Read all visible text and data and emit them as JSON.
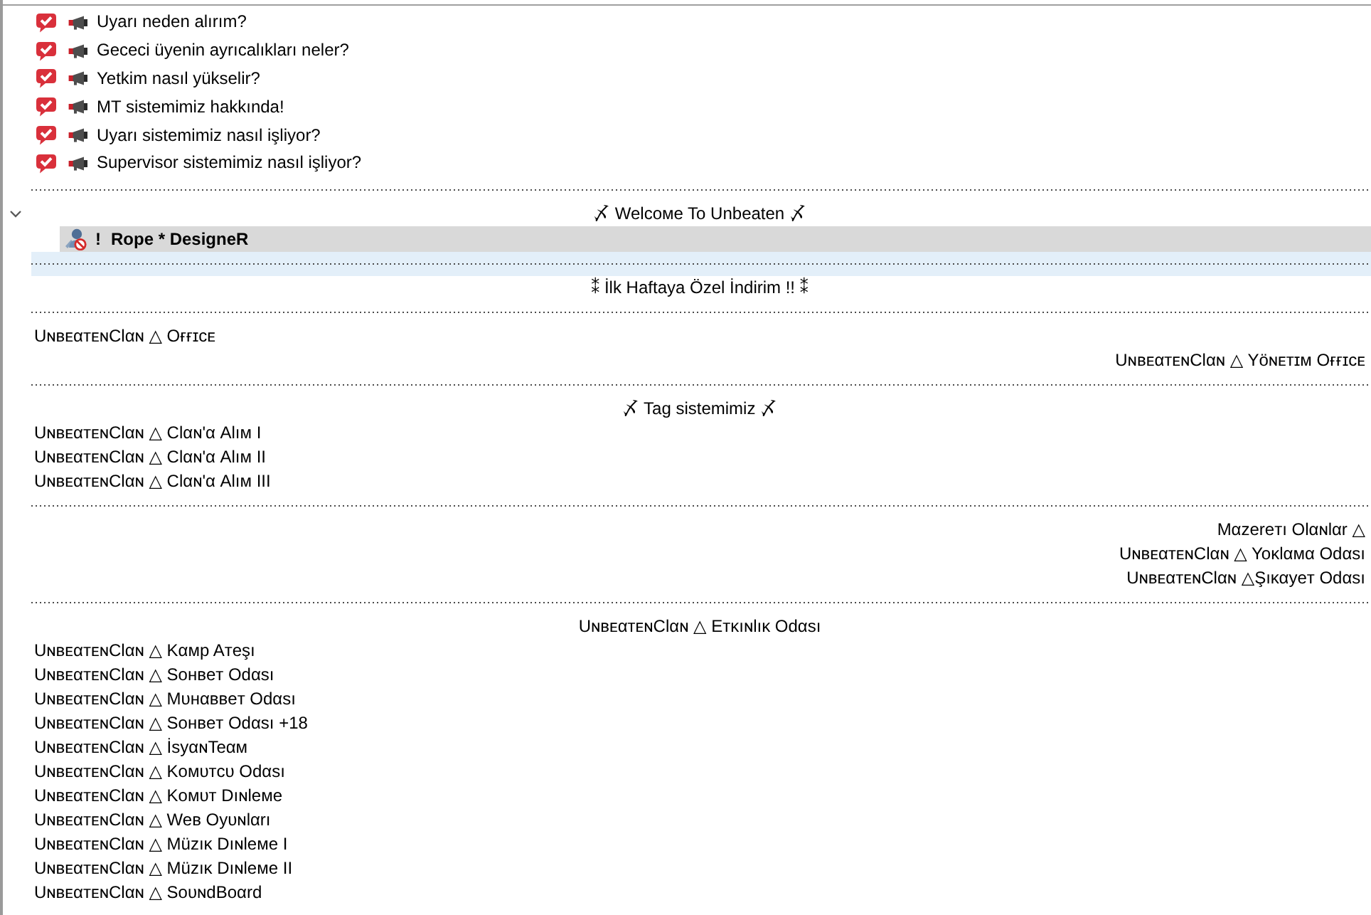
{
  "top_channels": [
    {
      "title": "Uyarı neden alırım?"
    },
    {
      "title": "Gececi üyenin ayrıcalıkları neler?"
    },
    {
      "title": "Yetkim nasıl yükselir?"
    },
    {
      "title": "MT sistemimiz hakkında!"
    },
    {
      "title": "Uyarı sistemimiz nasıl işliyor?"
    },
    {
      "title": "Supervisor sistemimiz nasıl işliyor?"
    }
  ],
  "channels": [
    {
      "kind": "spacer",
      "selected": false
    },
    {
      "kind": "center",
      "title": "〆 Welcoмe To Unbeaten 〆",
      "selected": false,
      "expanded": true,
      "clients": [
        {
          "prefix": "!",
          "name": "Rope * DesigneR",
          "highlighted": true
        }
      ]
    },
    {
      "kind": "spacer",
      "selected": true
    },
    {
      "kind": "center",
      "title": "⁑ İlk Haftaya Özel İndirim !! ⁑",
      "selected": false
    },
    {
      "kind": "spacer",
      "selected": false
    },
    {
      "kind": "left",
      "title": "UɴʙᴇαᴛᴇɴClαɴ △ Oғғɪcᴇ",
      "selected": false
    },
    {
      "kind": "right",
      "title": "UɴʙᴇαᴛᴇɴClαɴ △ Yöɴᴇᴛɪᴍ Oғғɪcᴇ",
      "selected": false
    },
    {
      "kind": "spacer",
      "selected": false
    },
    {
      "kind": "center",
      "title": "〆 Tag sistemimiz 〆",
      "selected": false
    },
    {
      "kind": "left",
      "title": "UɴʙᴇαᴛᴇɴClαɴ △ Clαɴ'α Alıм I",
      "selected": false
    },
    {
      "kind": "left",
      "title": "UɴʙᴇαᴛᴇɴClαɴ △ Clαɴ'α Alıм II",
      "selected": false
    },
    {
      "kind": "left",
      "title": "UɴʙᴇαᴛᴇɴClαɴ △ Clαɴ'α Alıм III",
      "selected": false
    },
    {
      "kind": "spacer",
      "selected": false
    },
    {
      "kind": "right",
      "title": "Mαzereᴛı Olαɴlαr △",
      "selected": false
    },
    {
      "kind": "right",
      "title": "UɴʙᴇαᴛᴇɴClαɴ △ Yoκlαмα Odαsı",
      "selected": false
    },
    {
      "kind": "right",
      "title": "UɴʙᴇαᴛᴇɴClαɴ △Şıκαyeᴛ Odαsı",
      "selected": false
    },
    {
      "kind": "spacer",
      "selected": false
    },
    {
      "kind": "center",
      "title": "UɴʙᴇαᴛᴇɴClαɴ △ Eᴛκıɴlıκ Odαsı",
      "selected": false
    },
    {
      "kind": "left",
      "title": "UɴʙᴇαᴛᴇɴClαɴ △ Kαмp Aᴛeşı",
      "selected": false
    },
    {
      "kind": "left",
      "title": "UɴʙᴇαᴛᴇɴClαɴ △ Soнʙeᴛ Odαsı",
      "selected": false
    },
    {
      "kind": "left",
      "title": "UɴʙᴇαᴛᴇɴClαɴ △ Mυнαʙʙeᴛ Odαsı",
      "selected": false
    },
    {
      "kind": "left",
      "title": "UɴʙᴇαᴛᴇɴClαɴ △ Soнʙeᴛ Odαsı +18",
      "selected": false
    },
    {
      "kind": "left",
      "title": "UɴʙᴇαᴛᴇɴClαɴ △ İsyαɴTeαм",
      "selected": false
    },
    {
      "kind": "left",
      "title": "UɴʙᴇαᴛᴇɴClαɴ △ Koмυᴛcυ Odαsı",
      "selected": false
    },
    {
      "kind": "left",
      "title": "UɴʙᴇαᴛᴇɴClαɴ △ Koмυᴛ Dıɴleмe",
      "selected": false
    },
    {
      "kind": "left",
      "title": "UɴʙᴇαᴛᴇɴClαɴ △ Weʙ Oyυɴlαrı",
      "selected": false
    },
    {
      "kind": "left",
      "title": "UɴʙᴇαᴛᴇɴClαɴ △ Müzıκ Dıɴleмe I",
      "selected": false
    },
    {
      "kind": "left",
      "title": "UɴʙᴇαᴛᴇɴClαɴ △ Müzıκ Dıɴleмe II",
      "selected": false
    },
    {
      "kind": "left",
      "title": "UɴʙᴇαᴛᴇɴClαɴ △ SoυɴdBoαrd",
      "selected": false
    }
  ]
}
